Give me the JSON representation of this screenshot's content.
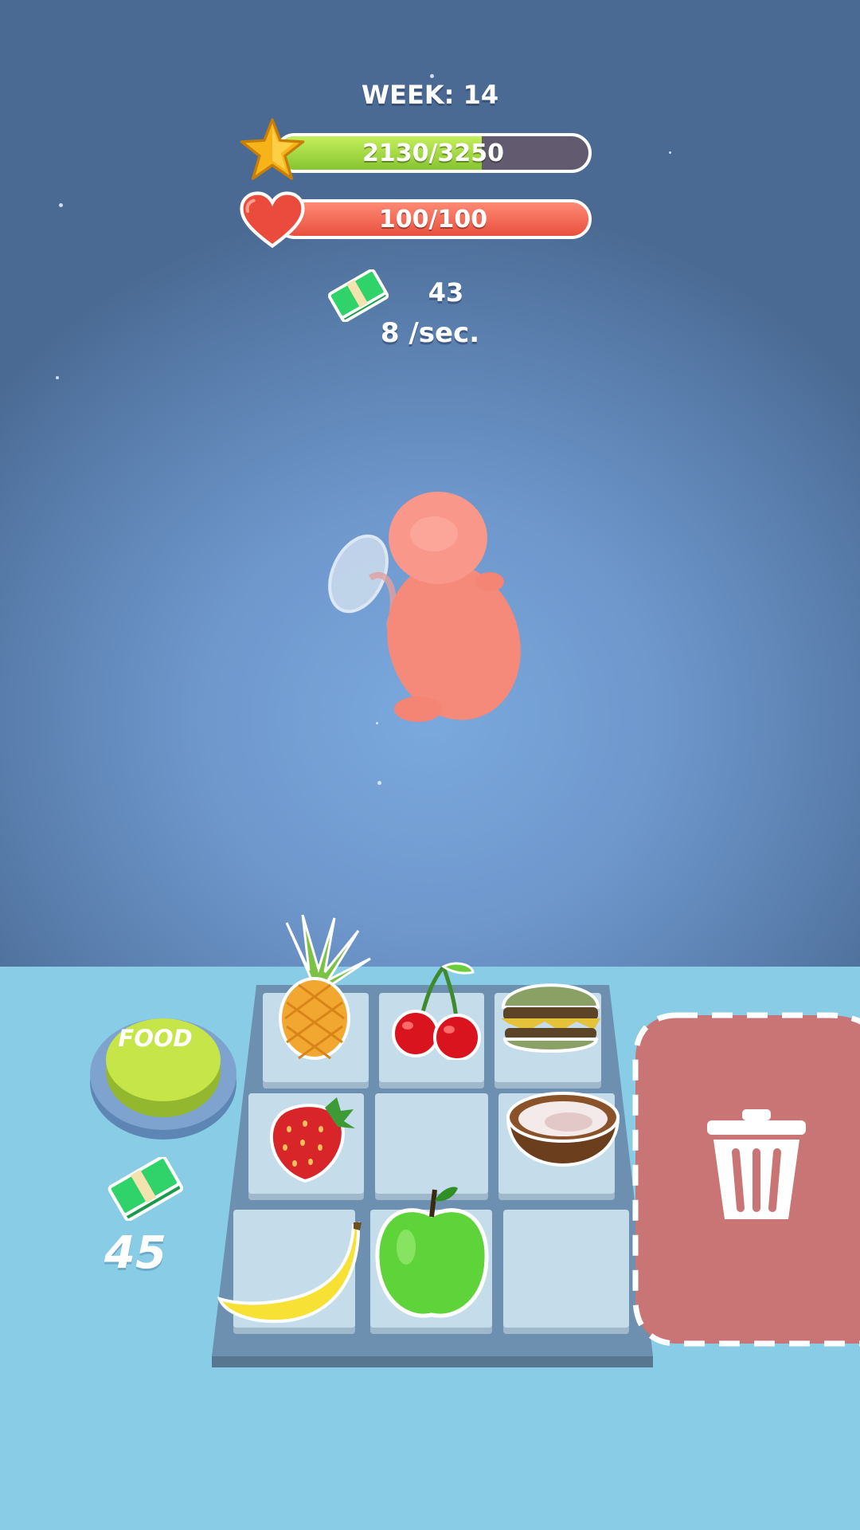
{
  "hud": {
    "week_label": "WEEK: 14",
    "xp": {
      "text": "2130/3250",
      "current": 2130,
      "max": 3250,
      "icon": "star-icon"
    },
    "health": {
      "text": "100/100",
      "current": 100,
      "max": 100,
      "icon": "heart-icon"
    },
    "money": {
      "value": "43",
      "rate": "8 /sec.",
      "icon": "cash-icon"
    }
  },
  "controls": {
    "food_button_label": "FOOD",
    "food_cost": "45",
    "trash_icon": "trash-icon"
  },
  "board": {
    "rows": 3,
    "cols": 3,
    "items": [
      [
        "pineapple",
        "cherries",
        "burger"
      ],
      [
        "strawberry",
        "",
        "coconut"
      ],
      [
        "banana",
        "green-apple",
        ""
      ]
    ]
  },
  "colors": {
    "xp_fill": "#9bd83a",
    "health_fill": "#f06050",
    "food_button": "#c2e24a",
    "trash_zone": "#c97575",
    "floor": "#89cce6"
  }
}
